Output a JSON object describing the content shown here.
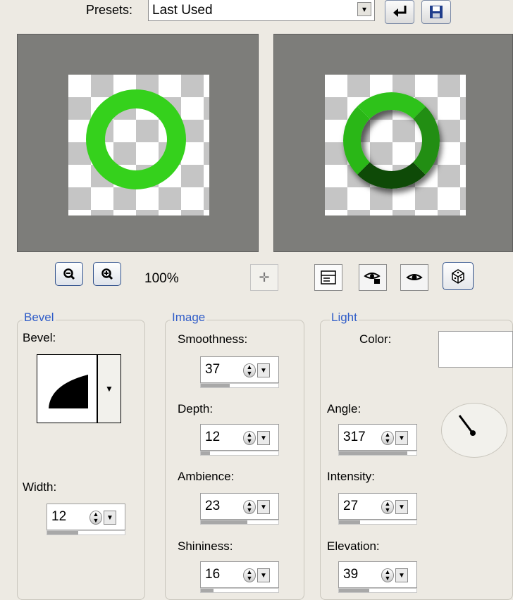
{
  "presets": {
    "label": "Presets:",
    "value": "Last Used"
  },
  "icons": {
    "dropdown": "chevron-down-icon",
    "reset": "reset-arrow-icon",
    "save": "save-disk-icon",
    "zoom_out": "zoom-out-icon",
    "zoom_in": "zoom-in-icon",
    "pan": "pan-icon",
    "proof": "proof-icon",
    "lock": "eye-lock-icon",
    "eye": "eye-icon",
    "randomize": "dice-icon"
  },
  "zoom": {
    "label": "100%"
  },
  "colors": {
    "accent_blue": "#2f5cc8",
    "ring_green": "#35d11c",
    "preview_gray": "#7d7d7a"
  },
  "bevel": {
    "legend": "Bevel",
    "bevel_label": "Bevel:",
    "width_label": "Width:",
    "width_value": "12",
    "width_fill": 0.4
  },
  "image": {
    "legend": "Image",
    "smoothness_label": "Smoothness:",
    "smoothness_value": "37",
    "smoothness_fill": 0.37,
    "depth_label": "Depth:",
    "depth_value": "12",
    "depth_fill": 0.12,
    "ambience_label": "Ambience:",
    "ambience_value": "23",
    "ambience_fill": 0.6,
    "shininess_label": "Shininess:",
    "shininess_value": "16",
    "shininess_fill": 0.16
  },
  "light": {
    "legend": "Light",
    "color_label": "Color:",
    "color_value": "#ffffff",
    "angle_label": "Angle:",
    "angle_value": "317",
    "angle_fill": 0.88,
    "intensity_label": "Intensity:",
    "intensity_value": "27",
    "intensity_fill": 0.27,
    "elevation_label": "Elevation:",
    "elevation_value": "39",
    "elevation_fill": 0.39
  }
}
